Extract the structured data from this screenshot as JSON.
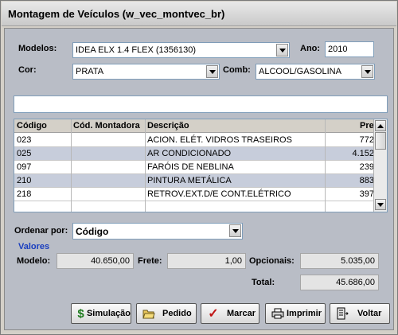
{
  "window": {
    "title": "Montagem de Veículos (w_vec_montvec_br)"
  },
  "form": {
    "modelos_label": "Modelos:",
    "modelos_value": "IDEA ELX 1.4 FLEX (1356130)",
    "ano_label": "Ano:",
    "ano_value": "2010",
    "cor_label": "Cor:",
    "cor_value": "PRATA",
    "comb_label": "Comb:",
    "comb_value": "ALCOOL/GASOLINA",
    "search_value": ""
  },
  "grid": {
    "columns": [
      "Código",
      "Cód. Montadora",
      "Descrição",
      "Pre"
    ],
    "rows": [
      {
        "codigo": "023",
        "cod_montadora": "",
        "descricao": "ACION. ELÉT. VIDROS TRASEIROS",
        "preco": "772"
      },
      {
        "codigo": "025",
        "cod_montadora": "",
        "descricao": "AR CONDICIONADO",
        "preco": "4.152"
      },
      {
        "codigo": "097",
        "cod_montadora": "",
        "descricao": "FARÓIS DE NEBLINA",
        "preco": "239"
      },
      {
        "codigo": "210",
        "cod_montadora": "",
        "descricao": "PINTURA METÁLICA",
        "preco": "883"
      },
      {
        "codigo": "218",
        "cod_montadora": "",
        "descricao": "RETROV.EXT.D/E CONT.ELÉTRICO",
        "preco": "397"
      }
    ]
  },
  "ordenar": {
    "label": "Ordenar por:",
    "value": "Código"
  },
  "valores": {
    "heading": "Valores",
    "modelo_label": "Modelo:",
    "modelo_value": "40.650,00",
    "frete_label": "Frete:",
    "frete_value": "1,00",
    "opcionais_label": "Opcionais:",
    "opcionais_value": "5.035,00",
    "total_label": "Total:",
    "total_value": "45.686,00"
  },
  "buttons": {
    "simulacao": "Simulação",
    "pedido": "Pedido",
    "marcar": "Marcar",
    "imprimir": "Imprimir",
    "voltar": "Voltar"
  },
  "icons": {
    "simulacao": "dollar-icon",
    "pedido": "folder-open-icon",
    "marcar": "checkmark-icon",
    "imprimir": "printer-icon",
    "voltar": "exit-door-icon"
  },
  "colors": {
    "accent": "#1a3fbf",
    "panel": "#b9bdc6",
    "row_alt": "#c7cddb"
  }
}
